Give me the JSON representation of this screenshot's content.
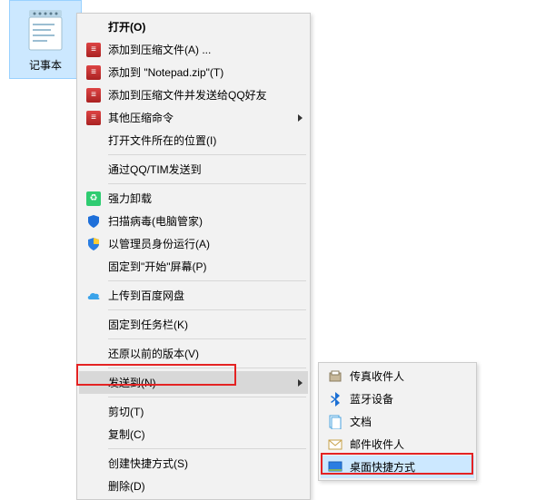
{
  "desktop_icon": {
    "label": "记事本"
  },
  "main_menu": {
    "items": [
      {
        "label": "打开(O)"
      },
      {
        "label": "添加到压缩文件(A) ..."
      },
      {
        "label": "添加到 \"Notepad.zip\"(T)"
      },
      {
        "label": "添加到压缩文件并发送给QQ好友"
      },
      {
        "label": "其他压缩命令"
      },
      {
        "label": "打开文件所在的位置(I)"
      },
      {
        "label": "通过QQ/TIM发送到"
      },
      {
        "label": "强力卸载"
      },
      {
        "label": "扫描病毒(电脑管家)"
      },
      {
        "label": "以管理员身份运行(A)"
      },
      {
        "label": "固定到\"开始\"屏幕(P)"
      },
      {
        "label": "上传到百度网盘"
      },
      {
        "label": "固定到任务栏(K)"
      },
      {
        "label": "还原以前的版本(V)"
      },
      {
        "label": "发送到(N)"
      },
      {
        "label": "剪切(T)"
      },
      {
        "label": "复制(C)"
      },
      {
        "label": "创建快捷方式(S)"
      },
      {
        "label": "删除(D)"
      }
    ]
  },
  "sub_menu": {
    "items": [
      {
        "label": "传真收件人"
      },
      {
        "label": "蓝牙设备"
      },
      {
        "label": "文档"
      },
      {
        "label": "邮件收件人"
      },
      {
        "label": "桌面快捷方式"
      }
    ]
  },
  "colors": {
    "highlight": "#e42323",
    "hover_gray": "#d8d8d8",
    "hover_blue": "#cce8ff"
  }
}
